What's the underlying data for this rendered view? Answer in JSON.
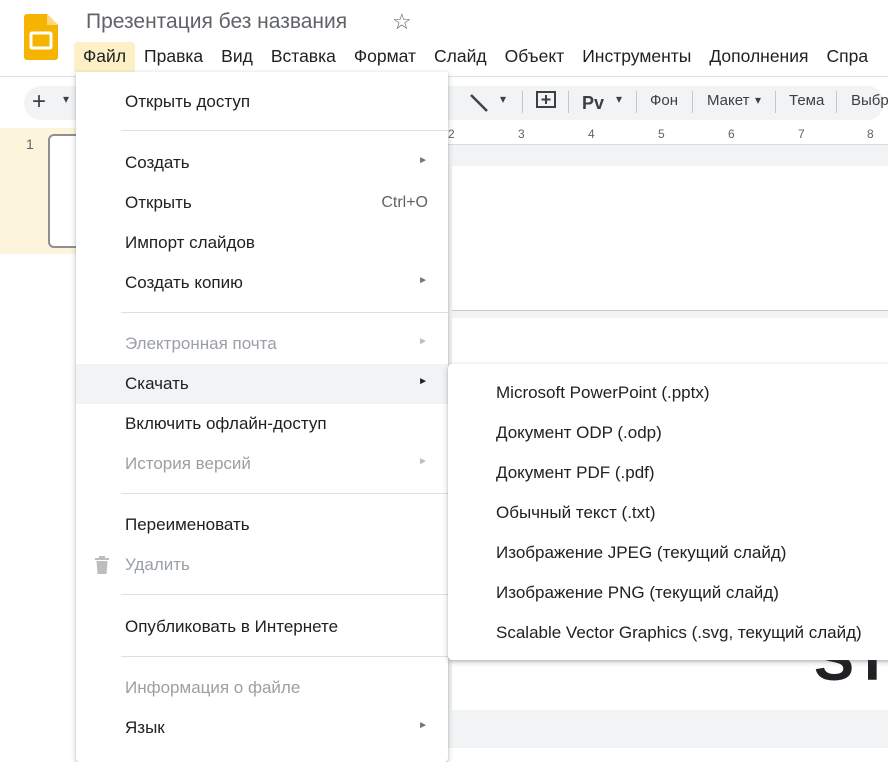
{
  "app": {
    "title": "Презентация без названия",
    "logo": "slides-logo",
    "star_icon": "☆"
  },
  "menubar": [
    {
      "label": "Файл",
      "active": true
    },
    {
      "label": "Правка"
    },
    {
      "label": "Вид"
    },
    {
      "label": "Вставка"
    },
    {
      "label": "Формат"
    },
    {
      "label": "Слайд"
    },
    {
      "label": "Объект"
    },
    {
      "label": "Инструменты"
    },
    {
      "label": "Дополнения"
    },
    {
      "label": "Спра"
    }
  ],
  "toolbar": {
    "add_icon": "+",
    "dropdown_icon": "▾",
    "background_label": "Фон",
    "layout_label": "Макет",
    "theme_label": "Тема",
    "select_label": "Выбр"
  },
  "filmstrip": {
    "slide_number": "1"
  },
  "ruler": {
    "ticks": [
      "2",
      "3",
      "4",
      "5",
      "6",
      "7",
      "8"
    ]
  },
  "slide": {
    "visible_glyph": "ST"
  },
  "file_menu": {
    "items": [
      {
        "label": "Открыть доступ"
      },
      {
        "label": "Создать",
        "submenu": true
      },
      {
        "label": "Открыть",
        "shortcut": "Ctrl+O"
      },
      {
        "label": "Импорт слайдов"
      },
      {
        "label": "Создать копию",
        "submenu": true
      },
      {
        "label": "Электронная почта",
        "submenu": true,
        "disabled": true
      },
      {
        "label": "Скачать",
        "submenu": true,
        "highlighted": true
      },
      {
        "label": "Включить офлайн-доступ"
      },
      {
        "label": "История версий",
        "submenu": true,
        "disabled": true
      },
      {
        "label": "Переименовать"
      },
      {
        "label": "Удалить",
        "disabled": true,
        "icon": "trash-icon"
      },
      {
        "label": "Опубликовать в Интернете"
      },
      {
        "label": "Информация о файле",
        "disabled": true
      },
      {
        "label": "Язык",
        "submenu": true
      }
    ],
    "submenu_arrow": "►"
  },
  "download_submenu": {
    "items": [
      "Microsoft PowerPoint (.pptx)",
      "Документ ODP (.odp)",
      "Документ PDF (.pdf)",
      "Обычный текст (.txt)",
      "Изображение JPEG (текущий слайд)",
      "Изображение PNG (текущий слайд)",
      "Scalable Vector Graphics (.svg, текущий слайд)"
    ]
  },
  "colors": {
    "active_menu_bg": "#fdf0c7",
    "hover_bg": "#f1f3f4",
    "disabled_text": "#9aa0a6",
    "logo_yellow": "#f4b400"
  }
}
